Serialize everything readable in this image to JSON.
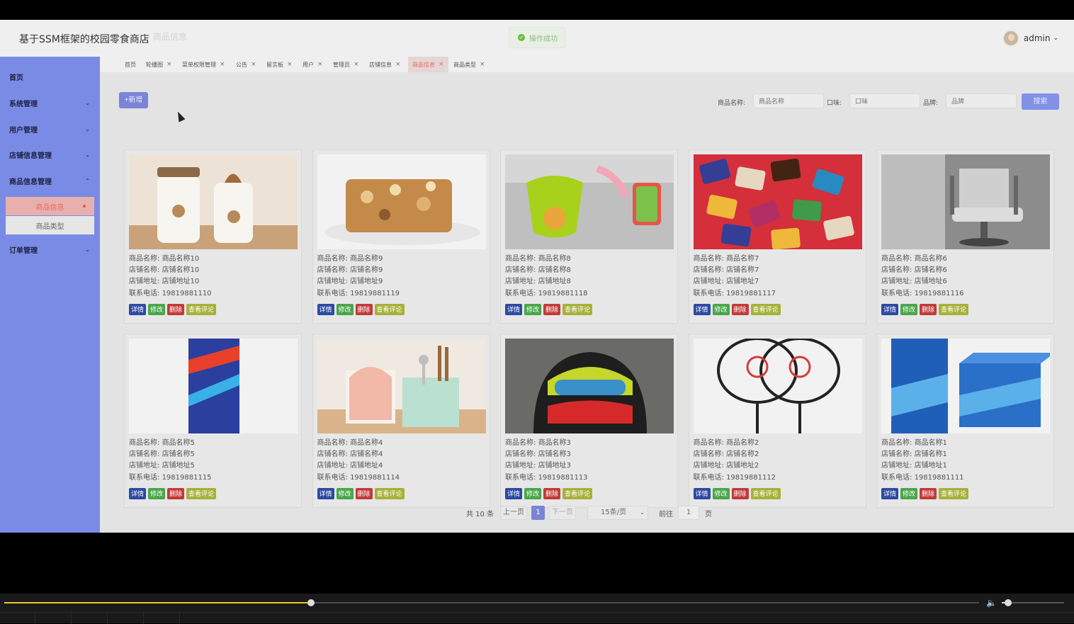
{
  "app": {
    "title": "基于SSM框架的校园零食商店",
    "ghost_title": "商品信息"
  },
  "toast": {
    "message": "操作成功",
    "icon": "check-circle-icon",
    "color": "#67c23a"
  },
  "user": {
    "name": "admin",
    "icon": "chevron-down-icon"
  },
  "sidebar": {
    "items": [
      {
        "label": "首页",
        "has_arrow": false
      },
      {
        "label": "系统管理",
        "has_arrow": true,
        "expanded": false
      },
      {
        "label": "用户管理",
        "has_arrow": true,
        "expanded": false
      },
      {
        "label": "店铺信息管理",
        "has_arrow": true,
        "expanded": false
      },
      {
        "label": "商品信息管理",
        "has_arrow": true,
        "expanded": true
      },
      {
        "label": "订单管理",
        "has_arrow": true,
        "expanded": false
      }
    ],
    "subitems": [
      {
        "label": "商品信息",
        "active": true
      },
      {
        "label": "商品类型",
        "active": false
      }
    ],
    "arrow_down": "⌄",
    "arrow_up": "⌃"
  },
  "tabs": [
    {
      "label": "首页",
      "closable": false
    },
    {
      "label": "轮播图",
      "closable": true
    },
    {
      "label": "菜单权限管理",
      "closable": true
    },
    {
      "label": "公告",
      "closable": true
    },
    {
      "label": "留言板",
      "closable": true
    },
    {
      "label": "用户",
      "closable": true
    },
    {
      "label": "管理员",
      "closable": true
    },
    {
      "label": "店铺信息",
      "closable": true
    },
    {
      "label": "商品信息",
      "closable": true,
      "active": true
    },
    {
      "label": "商品类型",
      "closable": true
    }
  ],
  "toolbar": {
    "add_label": "+新增"
  },
  "search": {
    "name_label": "商品名称:",
    "name_placeholder": "商品名称",
    "flavor_label": "口味:",
    "flavor_placeholder": "口味",
    "brand_label": "品牌:",
    "brand_placeholder": "品牌",
    "button_label": "搜索"
  },
  "card_labels": {
    "name": "商品名称:",
    "shop": "店铺名称:",
    "address": "店铺地址:",
    "phone": "联系电话:",
    "detail": "详情",
    "edit": "修改",
    "delete": "删除",
    "review": "查看评论"
  },
  "products": [
    {
      "name": "商品名称10",
      "shop": "店铺名称10",
      "address": "店铺地址10",
      "phone": "19819881110",
      "image": "cups"
    },
    {
      "name": "商品名称9",
      "shop": "店铺名称9",
      "address": "店铺地址9",
      "phone": "19819881119",
      "image": "nut-bar"
    },
    {
      "name": "商品名称8",
      "shop": "店铺名称8",
      "address": "店铺地址8",
      "phone": "19819881118",
      "image": "sink-basket"
    },
    {
      "name": "商品名称7",
      "shop": "店铺名称7",
      "address": "店铺地址7",
      "phone": "19819881117",
      "image": "chocolates"
    },
    {
      "name": "商品名称6",
      "shop": "店铺名称6",
      "address": "店铺地址6",
      "phone": "19819881116",
      "image": "chair"
    },
    {
      "name": "商品名称5",
      "shop": "店铺名称5",
      "address": "店铺地址5",
      "phone": "19819881115",
      "image": "can"
    },
    {
      "name": "商品名称4",
      "shop": "店铺名称4",
      "address": "店铺地址4",
      "phone": "19819881114",
      "image": "utensil-holder"
    },
    {
      "name": "商品名称3",
      "shop": "店铺名称3",
      "address": "店铺地址3",
      "phone": "19819881113",
      "image": "helmet"
    },
    {
      "name": "商品名称2",
      "shop": "店铺名称2",
      "address": "店铺地址2",
      "phone": "19819881112",
      "image": "rackets"
    },
    {
      "name": "商品名称1",
      "shop": "店铺名称1",
      "address": "店铺地址1",
      "phone": "19819881111",
      "image": "beer-box"
    }
  ],
  "pagination": {
    "total": "共 10 条",
    "prev": "上一页",
    "current": "1",
    "next": "下一页",
    "page_size": "15条/页",
    "goto_label": "前往",
    "goto_value": "1",
    "page_suffix": "页"
  },
  "player": {
    "progress": 0.315,
    "volume": 0.1
  }
}
